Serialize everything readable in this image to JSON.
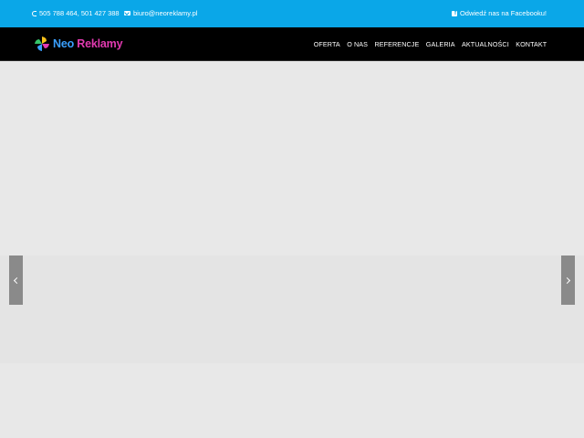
{
  "topbar": {
    "phone": "505 788 464, 501 427 388",
    "phone_icon": "phone-icon",
    "email": "biuro@neoreklamy.pl",
    "email_icon": "envelope-icon",
    "facebook": "Odwiedź nas na Facebooku!",
    "facebook_icon": "facebook-icon",
    "bg_color": "#0aa7e8"
  },
  "navbar": {
    "logo_neo": "Neo",
    "logo_rest": "Reklamy",
    "menu": [
      {
        "label": "OFERTA"
      },
      {
        "label": "O NAS"
      },
      {
        "label": "REFERENCJE"
      },
      {
        "label": "GALERIA"
      },
      {
        "label": "AKTUALNOŚCI"
      },
      {
        "label": "KONTAKT"
      }
    ],
    "bg_color": "#000000"
  },
  "slider": {
    "prev_icon": "chevron-left-icon",
    "next_icon": "chevron-right-icon"
  }
}
